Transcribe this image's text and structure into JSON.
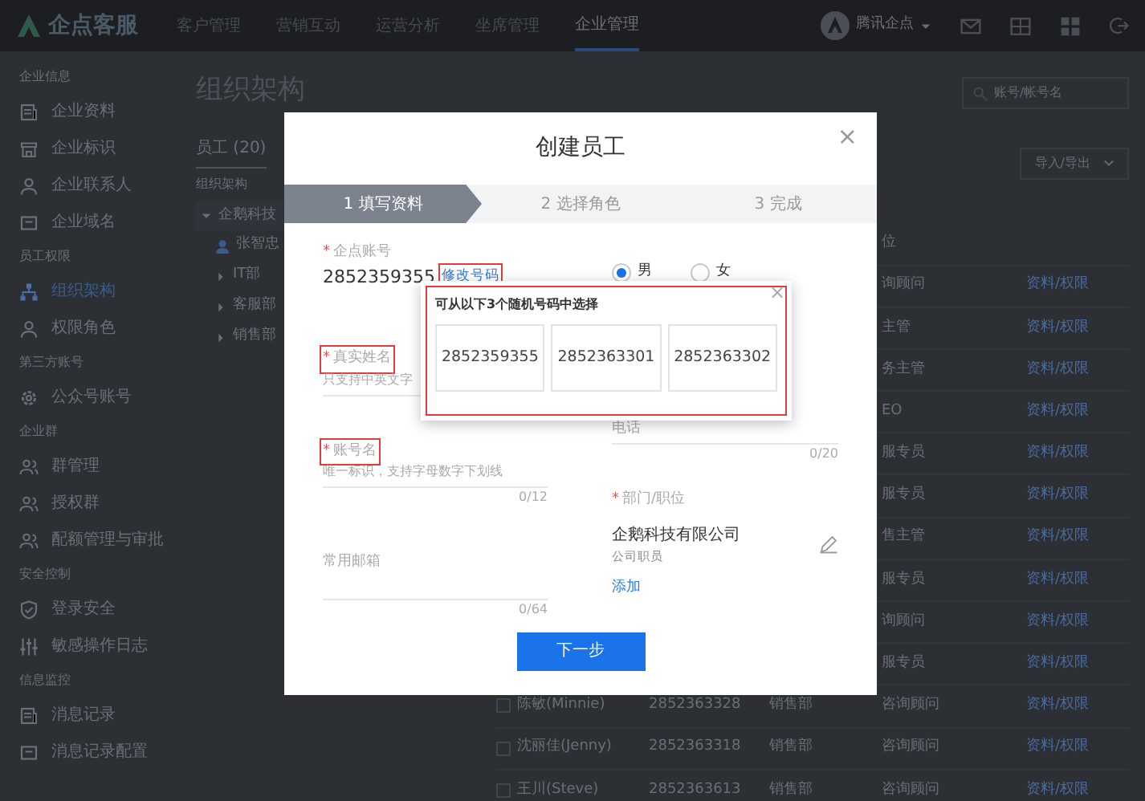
{
  "topbar": {
    "logo": "企点客服",
    "nav": [
      {
        "label": "客户管理",
        "selected": false
      },
      {
        "label": "营销互动",
        "selected": false
      },
      {
        "label": "运营分析",
        "selected": false
      },
      {
        "label": "坐席管理",
        "selected": false
      },
      {
        "label": "企业管理",
        "selected": true
      }
    ],
    "user": "腾讯企点"
  },
  "sidebar": [
    {
      "heading": "企业信息",
      "items": [
        {
          "label": "企业资料",
          "kind": "doc",
          "selected": false
        },
        {
          "label": "企业标识",
          "kind": "shop",
          "selected": false
        },
        {
          "label": "企业联系人",
          "kind": "person",
          "selected": false
        },
        {
          "label": "企业域名",
          "kind": "web",
          "selected": false
        }
      ]
    },
    {
      "heading": "员工权限",
      "items": [
        {
          "label": "组织架构",
          "kind": "tree",
          "selected": true
        },
        {
          "label": "权限角色",
          "kind": "person",
          "selected": false
        }
      ]
    },
    {
      "heading": "第三方账号",
      "items": [
        {
          "label": "公众号账号",
          "kind": "gear",
          "selected": false
        }
      ]
    },
    {
      "heading": "企业群",
      "items": [
        {
          "label": "群管理",
          "kind": "group",
          "selected": false
        },
        {
          "label": "授权群",
          "kind": "group",
          "selected": false
        },
        {
          "label": "配额管理与审批",
          "kind": "group",
          "selected": false
        }
      ]
    },
    {
      "heading": "安全控制",
      "items": [
        {
          "label": "登录安全",
          "kind": "shield",
          "selected": false
        },
        {
          "label": "敏感操作日志",
          "kind": "sliders",
          "selected": false
        }
      ]
    },
    {
      "heading": "信息监控",
      "items": [
        {
          "label": "消息记录",
          "kind": "doc",
          "selected": false
        },
        {
          "label": "消息记录配置",
          "kind": "web",
          "selected": false
        }
      ]
    }
  ],
  "main": {
    "title": "组织架构",
    "tab": "员工 (20)",
    "search": {
      "placeholder": "账号/帐号名"
    },
    "import_button": "导入/导出",
    "tree": {
      "heading": "组织架构",
      "root": {
        "label": "企鹅科技",
        "expanded": true
      },
      "children": [
        {
          "label": "张智忠",
          "kind": "person"
        },
        {
          "label": "IT部",
          "kind": "dept",
          "expanded": false
        },
        {
          "label": "客服部",
          "kind": "dept",
          "expanded": false
        },
        {
          "label": "销售部",
          "kind": "dept",
          "expanded": false
        }
      ]
    },
    "table": {
      "header": "位",
      "rows": [
        {
          "position": "询顾问",
          "action": "资料/权限"
        },
        {
          "position": "主管",
          "action": "资料/权限"
        },
        {
          "position": "务主管",
          "action": "资料/权限"
        },
        {
          "position": "EO",
          "action": "资料/权限"
        },
        {
          "position": "服专员",
          "action": "资料/权限"
        },
        {
          "position": "服专员",
          "action": "资料/权限"
        },
        {
          "position": "售主管",
          "action": "资料/权限"
        },
        {
          "position": "服专员",
          "action": "资料/权限"
        },
        {
          "position": "询顾问",
          "action": "资料/权限"
        },
        {
          "position": "服专员",
          "action": "资料/权限"
        },
        {
          "checked": false,
          "name": "陈敏(Minnie)",
          "account": "2852363328",
          "department": "销售部",
          "position": "咨询顾问",
          "action": "资料/权限"
        },
        {
          "checked": false,
          "name": "沈丽佳(Jenny)",
          "account": "2852363318",
          "department": "销售部",
          "position": "咨询顾问",
          "action": "资料/权限"
        },
        {
          "checked": false,
          "name": "王川(Steve)",
          "account": "2852363613",
          "department": "销售部",
          "position": "咨询顾问",
          "action": "资料/权限"
        }
      ]
    }
  },
  "modal": {
    "title": "创建员工",
    "close": "×",
    "steps": [
      {
        "label": "1 填写资料",
        "selected": true
      },
      {
        "label": "2 选择角色",
        "selected": false
      },
      {
        "label": "3 完成",
        "selected": false
      }
    ],
    "account": {
      "label": "企点账号",
      "marker": "*",
      "value": "2852359355",
      "link": "修改号码",
      "highlighted": true
    },
    "gender": [
      {
        "label": "男",
        "selected": true
      },
      {
        "label": "女",
        "selected": false
      }
    ],
    "popover": {
      "title": "可从以下3个随机号码中选择",
      "close": "×",
      "highlighted": true,
      "numbers": [
        "2852359355",
        "2852363301",
        "2852363302"
      ]
    },
    "fields_left": [
      {
        "label": "真实姓名",
        "marker": "*",
        "highlighted": true,
        "hint": "只支持中英文字"
      },
      {
        "label": "账号名",
        "marker": "*",
        "highlighted": true,
        "hint": "唯一标识，支持字母数字下划线",
        "counter": "0/12"
      },
      {
        "label": "常用邮箱",
        "counter": "0/64"
      }
    ],
    "phone": {
      "label": "电话",
      "counter": "0/20"
    },
    "department": {
      "label": "部门/职位",
      "marker": "*",
      "company": "企鹅科技有限公司",
      "role": "公司职员",
      "add": "添加"
    },
    "next_button": "下一步"
  }
}
